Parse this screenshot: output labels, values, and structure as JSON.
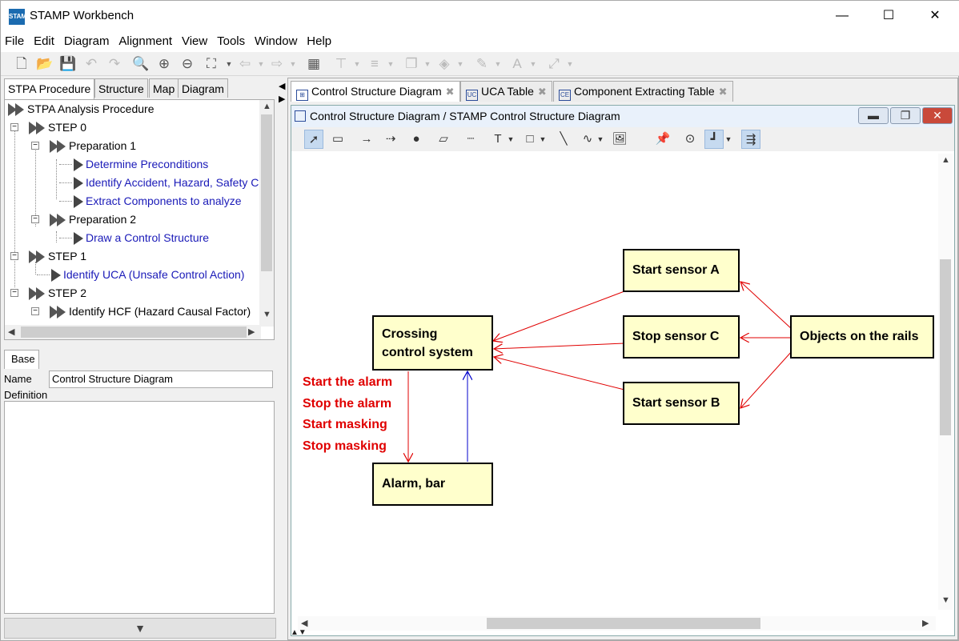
{
  "app": {
    "title": "STAMP Workbench",
    "icon_label": "STAMP"
  },
  "window_controls": {
    "minimize": "—",
    "maximize": "☐",
    "close": "✕"
  },
  "menu": [
    "File",
    "Edit",
    "Diagram",
    "Alignment",
    "View",
    "Tools",
    "Window",
    "Help"
  ],
  "left_tabs": [
    "STPA Procedure",
    "Structure",
    "Map",
    "Diagram"
  ],
  "tree": {
    "root": "STPA Analysis Procedure",
    "step0": "STEP 0",
    "prep1": "Preparation 1",
    "determine": "Determine Preconditions",
    "identify_acc": "Identify Accident, Hazard, Safety Co",
    "extract": "Extract Components to analyze",
    "prep2": "Preparation 2",
    "draw": "Draw a Control Structure",
    "step1": "STEP 1",
    "identify_uca": "Identify UCA (Unsafe Control Action)",
    "step2": "STEP 2",
    "identify_hcf": "Identify HCF (Hazard Causal Factor)"
  },
  "base": {
    "tab": "Base",
    "name_label": "Name",
    "name_value": "Control Structure Diagram",
    "definition_label": "Definition",
    "collapse_icon": "▼"
  },
  "editor_tabs": [
    {
      "label": "Control Structure Diagram",
      "icon": "diagram-icon"
    },
    {
      "label": "UCA Table",
      "icon": "UC"
    },
    {
      "label": "Component Extracting Table",
      "icon": "CE"
    }
  ],
  "inner_window": {
    "title": "Control Structure Diagram / STAMP Control Structure Diagram"
  },
  "diagram": {
    "crossing": "Crossing\ncontrol system",
    "alarm": "Alarm, bar",
    "sensor_a": "Start sensor A",
    "sensor_c": "Stop sensor C",
    "sensor_b": "Start sensor B",
    "objects": "Objects on the rails",
    "actions": [
      "Start the alarm",
      "Stop the alarm",
      "Start masking",
      "Stop masking"
    ],
    "colors": {
      "box_fill": "#ffffcc",
      "control_arrow": "#e00000",
      "feedback_arrow": "#0000cc"
    }
  }
}
